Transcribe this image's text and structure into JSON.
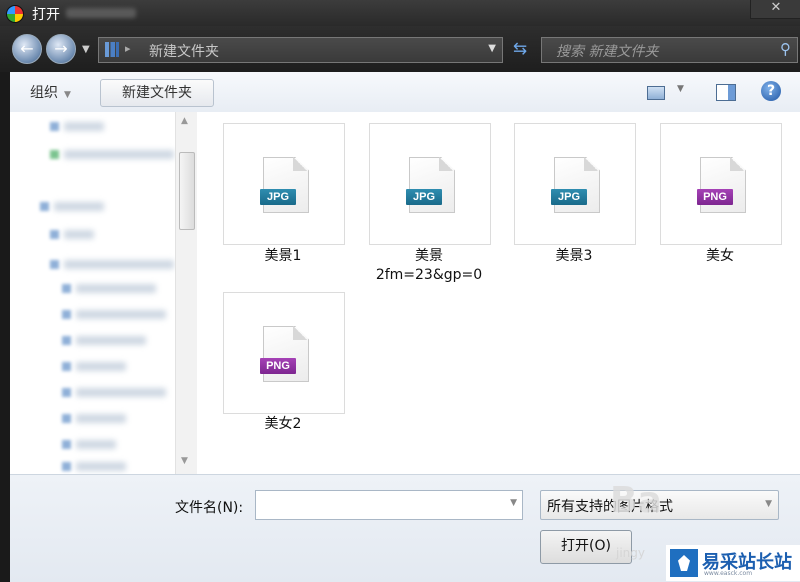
{
  "window": {
    "title": "打开",
    "close_label": "✕"
  },
  "address": {
    "path": "新建文件夹",
    "search_placeholder": "搜索 新建文件夹"
  },
  "toolbar": {
    "organize_label": "组织",
    "new_folder_label": "新建文件夹"
  },
  "files": [
    {
      "name": "美景1",
      "type": "JPG",
      "name_line2": ""
    },
    {
      "name": "美景",
      "type": "JPG",
      "name_line2": "2fm=23&gp=0"
    },
    {
      "name": "美景3",
      "type": "JPG",
      "name_line2": ""
    },
    {
      "name": "美女",
      "type": "PNG",
      "name_line2": ""
    },
    {
      "name": "美女2",
      "type": "PNG",
      "name_line2": ""
    }
  ],
  "bottom": {
    "filename_label": "文件名(N):",
    "filename_value": "",
    "filter_value": "所有支持的图片格式",
    "open_label": "打开(O)"
  },
  "watermarks": {
    "baidu": "Ba",
    "baidu_small": "jingy",
    "site_name": "易采站长站",
    "site_url": "www.easck.com"
  },
  "colors": {
    "jpg_badge": "#1f7ea0",
    "png_badge": "#952fa8",
    "titlebar": "#333333",
    "help": "#1f55a3"
  }
}
